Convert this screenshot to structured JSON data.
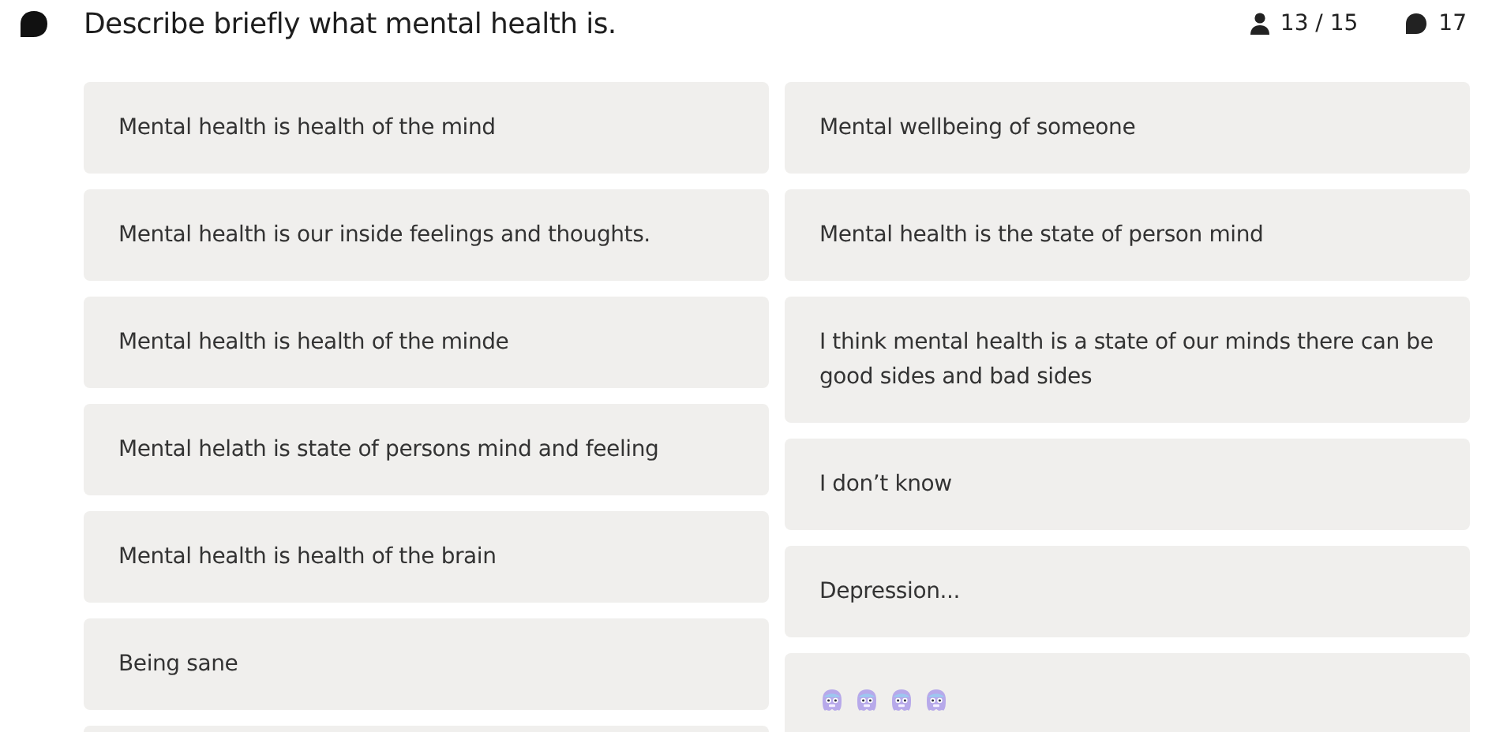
{
  "question": {
    "title": "Describe briefly what mental health is."
  },
  "stats": {
    "participants": "13 / 15",
    "responses": "17"
  },
  "columns": [
    [
      {
        "kind": "text",
        "text": "Mental health is health of the mind"
      },
      {
        "kind": "text",
        "text": "Mental health is our inside feelings and thoughts."
      },
      {
        "kind": "text",
        "text": "Mental health is health of the minde"
      },
      {
        "kind": "text",
        "text": "Mental helath is state of persons mind and feeling"
      },
      {
        "kind": "text",
        "text": "Mental health is health of the brain"
      },
      {
        "kind": "text",
        "text": "Being sane"
      },
      {
        "kind": "blank"
      }
    ],
    [
      {
        "kind": "text",
        "text": "Mental wellbeing of someone"
      },
      {
        "kind": "text",
        "text": "Mental health is the state of person mind"
      },
      {
        "kind": "text",
        "text": "I think mental health is a state of our minds there can be good sides and bad sides"
      },
      {
        "kind": "text",
        "text": "I don’t know"
      },
      {
        "kind": "text",
        "text": "Depression..."
      },
      {
        "kind": "emojis",
        "emojis": [
          {
            "kind": "face"
          },
          {
            "kind": "face"
          },
          {
            "kind": "face"
          },
          {
            "kind": "face"
          }
        ]
      }
    ]
  ]
}
